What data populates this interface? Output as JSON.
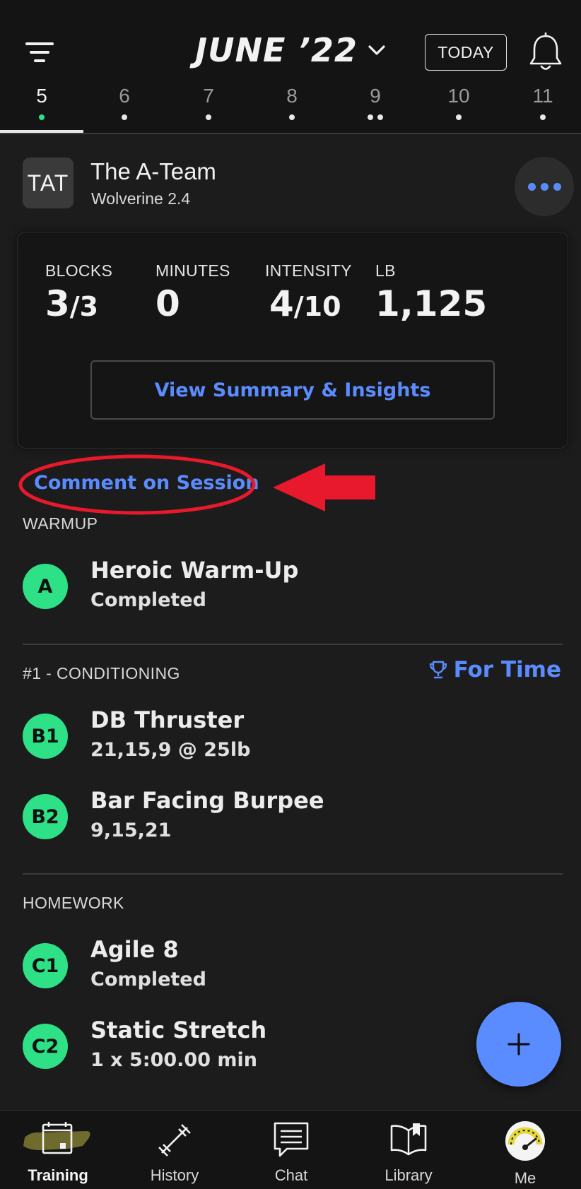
{
  "header": {
    "month_title": "JUNE ’22",
    "today_label": "TODAY",
    "days": [
      {
        "num": "5",
        "dots": 1,
        "active": true
      },
      {
        "num": "6",
        "dots": 1
      },
      {
        "num": "7",
        "dots": 1
      },
      {
        "num": "8",
        "dots": 1
      },
      {
        "num": "9",
        "dots": 2
      },
      {
        "num": "10",
        "dots": 1
      },
      {
        "num": "11",
        "dots": 1
      }
    ]
  },
  "team": {
    "badge": "TAT",
    "name": "The A-Team",
    "subtitle": "Wolverine 2.4"
  },
  "stats": {
    "blocks_label": "BLOCKS",
    "blocks_done": "3",
    "blocks_total": "/3",
    "minutes_label": "MINUTES",
    "minutes_value": "0",
    "intensity_label": "INTENSITY",
    "intensity_value": "4",
    "intensity_max": "/10",
    "lb_label": "LB",
    "lb_value": "1,125",
    "summary_button": "View Summary & Insights"
  },
  "comment_link": "Comment on Session",
  "annotation_color": "#e8192c",
  "sections": {
    "warmup_label": "WARMUP",
    "conditioning_label": "#1 - CONDITIONING",
    "conditioning_tag": "For Time",
    "homework_label": "HOMEWORK"
  },
  "exercises": {
    "a": {
      "badge": "A",
      "name": "Heroic Warm-Up",
      "detail": "Completed"
    },
    "b1": {
      "badge": "B1",
      "name": "DB Thruster",
      "detail": "21,15,9 @ 25lb"
    },
    "b2": {
      "badge": "B2",
      "name": "Bar Facing Burpee",
      "detail": "9,15,21"
    },
    "c1": {
      "badge": "C1",
      "name": "Agile 8",
      "detail": "Completed"
    },
    "c2": {
      "badge": "C2",
      "name": "Static Stretch",
      "detail": "1 x 5:00.00 min"
    }
  },
  "nav": {
    "training": "Training",
    "history": "History",
    "chat": "Chat",
    "library": "Library",
    "me": "Me"
  },
  "colors": {
    "accent_blue": "#5b8cff",
    "badge_green": "#2ee086",
    "background": "#1c1c1c"
  }
}
